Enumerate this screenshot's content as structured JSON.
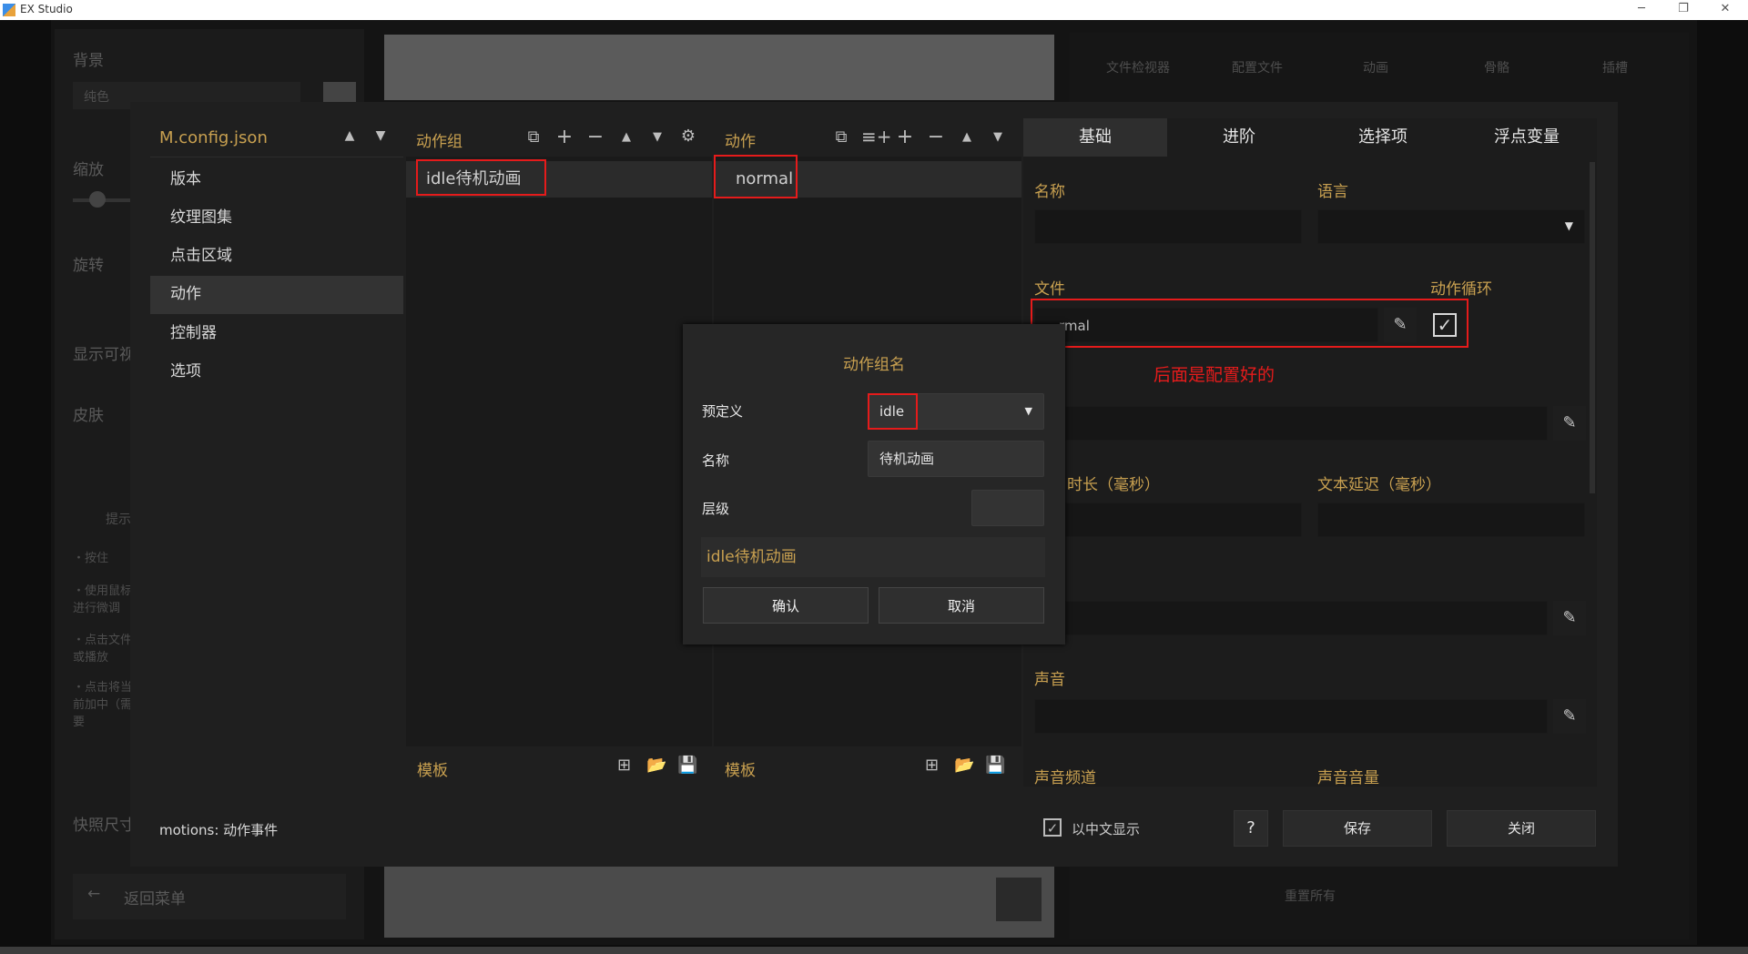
{
  "window": {
    "title": "EX Studio"
  },
  "bg": {
    "left_labels": [
      "背景",
      "纯色",
      "缩放",
      "旋转",
      "显示可视",
      "皮肤",
      "提示",
      "快照尺寸"
    ],
    "tips": [
      "・按住",
      "・使用鼠标进行微调",
      "・点击文件或播放",
      "・点击将当前加中（需要"
    ],
    "back_menu": "返回菜单",
    "right_tabs": [
      "文件检视器",
      "配置文件",
      "动画",
      "骨骼",
      "插槽"
    ],
    "reset_all": "重置所有"
  },
  "dialog": {
    "file_title": "M.config.json",
    "sidebar": [
      "版本",
      "纹理图集",
      "点击区域",
      "动作",
      "控制器",
      "选项"
    ],
    "active_sidebar": "动作",
    "groups_header": "动作组",
    "group_items": [
      "idle待机动画"
    ],
    "motions_header": "动作",
    "motion_items": [
      "normal"
    ],
    "template_label": "模板",
    "status_text": "motions: 动作事件",
    "tabs": [
      "基础",
      "进阶",
      "选择项",
      "浮点变量"
    ],
    "active_tab": "基础",
    "fields": {
      "name_label": "名称",
      "lang_label": "语言",
      "file_label": "文件",
      "loop_label": "动作循环",
      "file_value": "rmal",
      "duration_label": "时长（毫秒）",
      "text_delay_label": "文本延迟（毫秒）",
      "sound_label": "声音",
      "sound_channel_label": "声音频道",
      "sound_volume_label": "声音音量"
    },
    "annotation": "后面是配置好的",
    "chinese_display_label": "以中文显示",
    "help_label": "?",
    "save_label": "保存",
    "close_label": "关闭"
  },
  "modal": {
    "title": "动作组名",
    "predefined_label": "预定义",
    "predefined_value": "idle",
    "name_label": "名称",
    "name_value": "待机动画",
    "layer_label": "层级",
    "layer_value": "",
    "preview": "idle待机动画",
    "confirm_label": "确认",
    "cancel_label": "取消"
  },
  "colors": {
    "accent": "#c8a050",
    "highlight_red": "#e51b1b"
  }
}
